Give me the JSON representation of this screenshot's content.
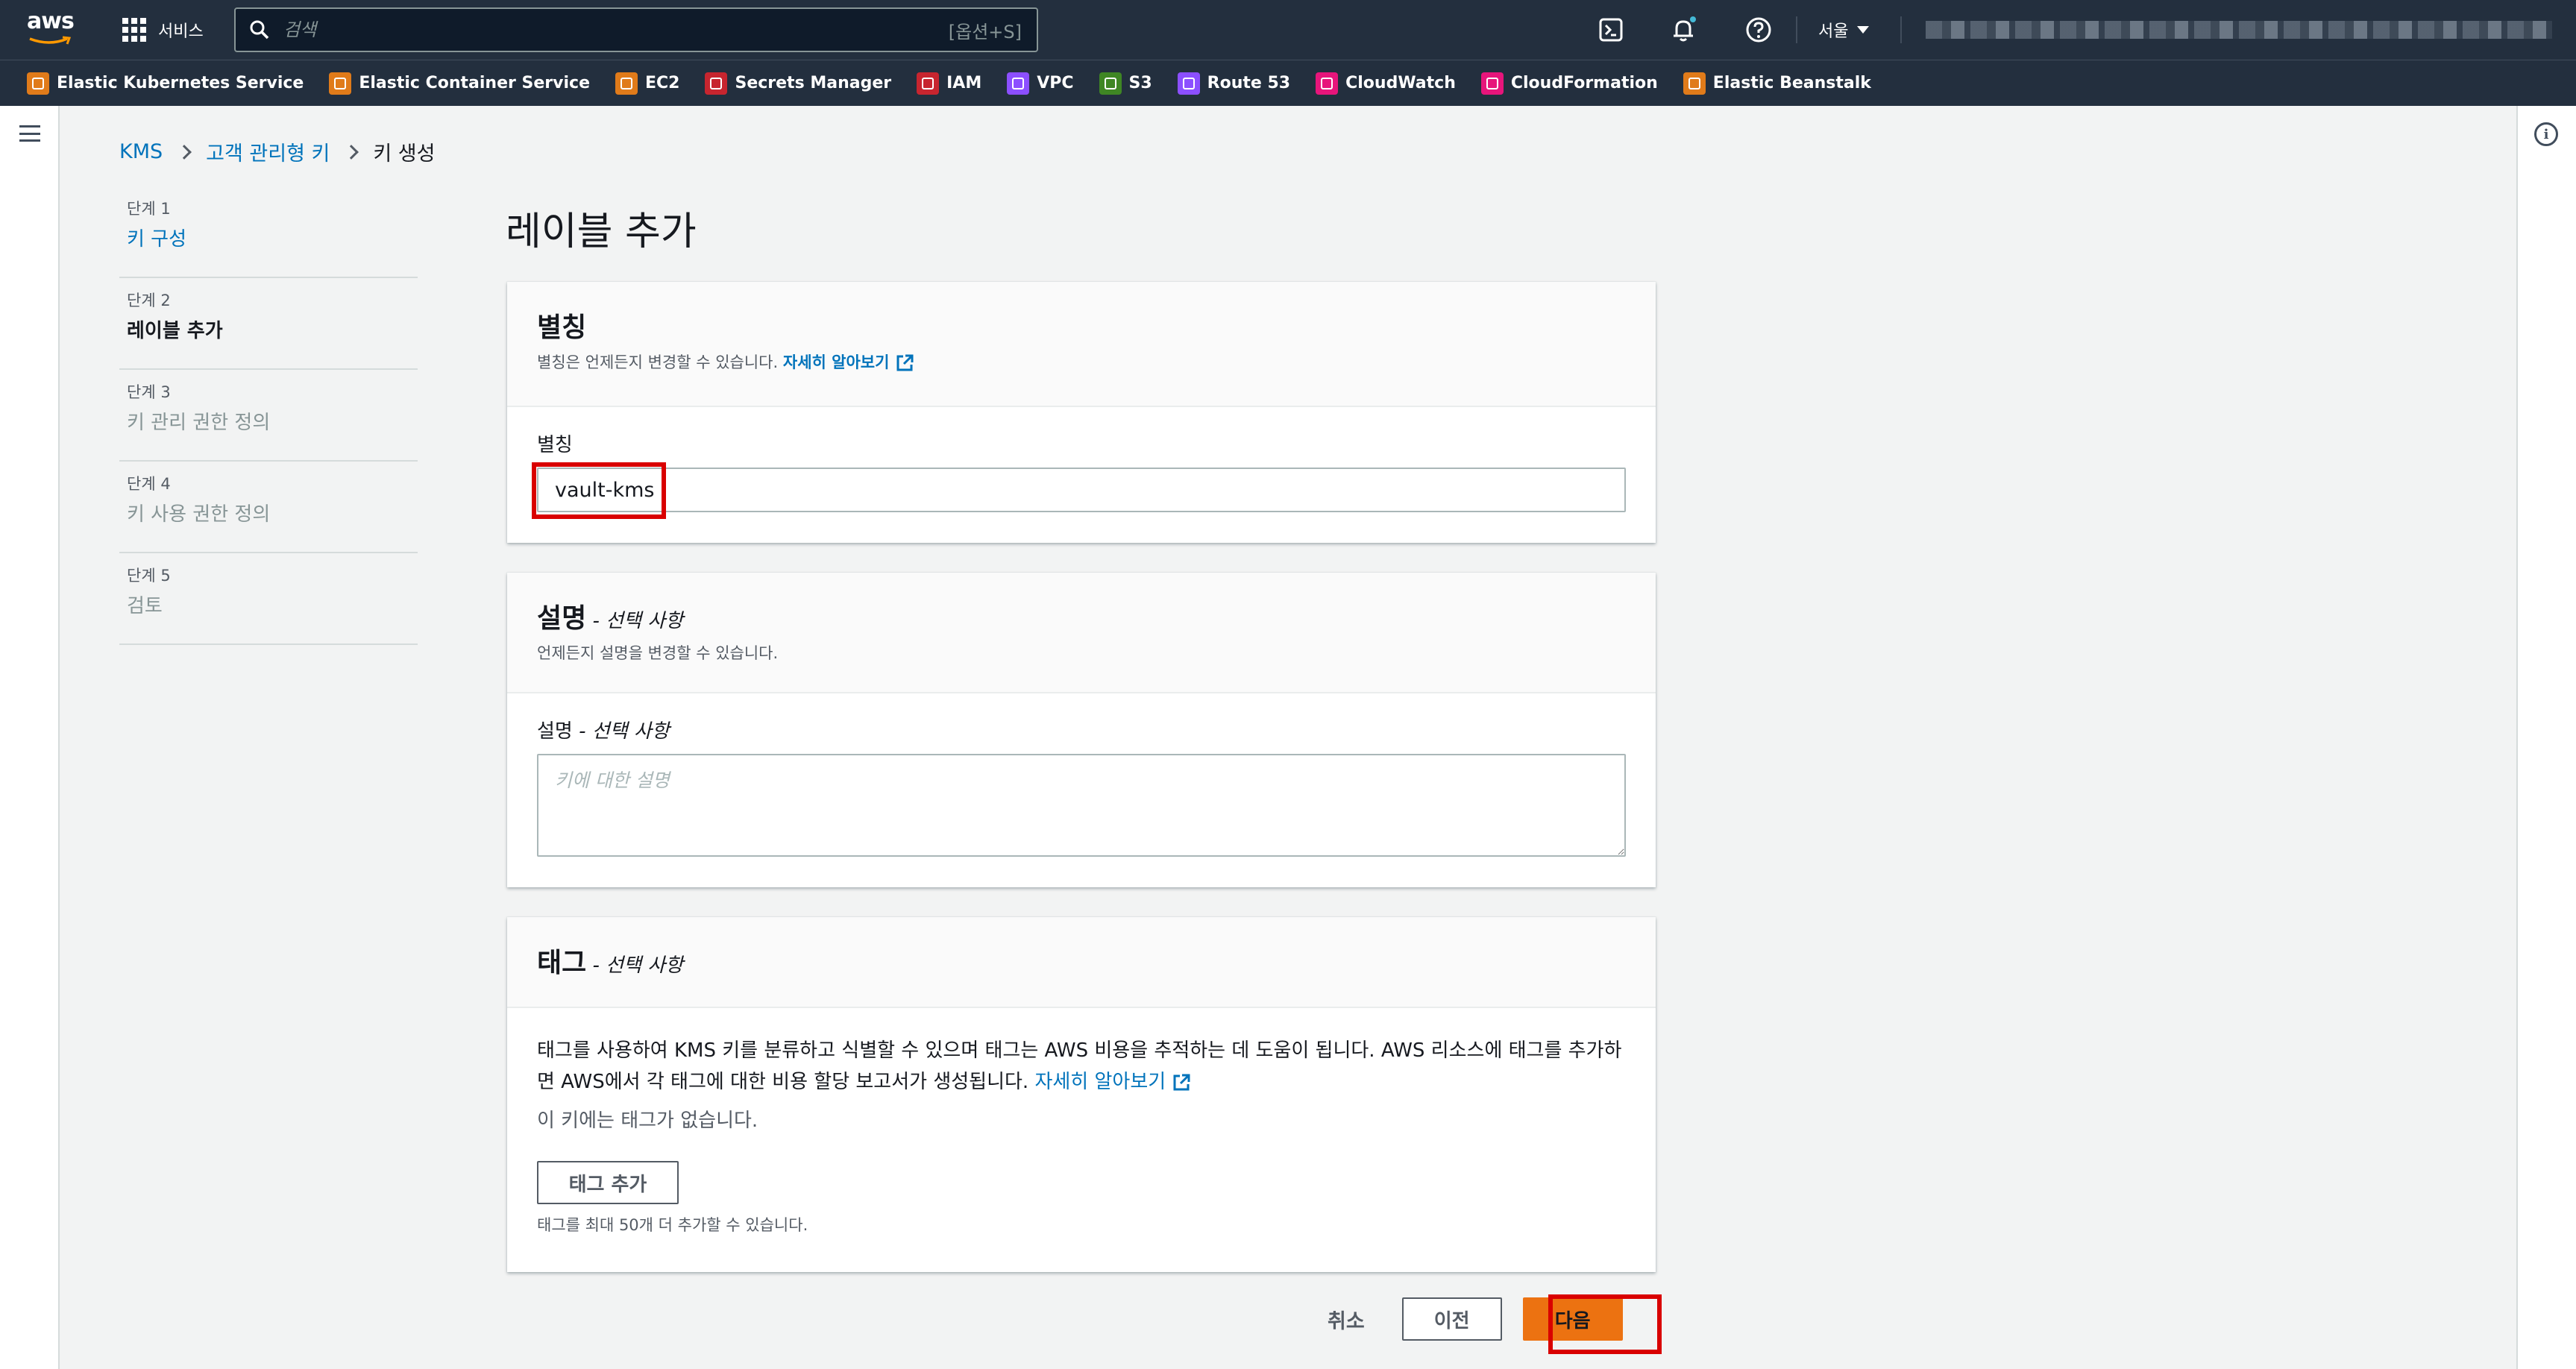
{
  "nav": {
    "logo": "aws",
    "services_label": "서비스",
    "search_placeholder": "검색",
    "search_shortcut": "[옵션+S]",
    "region": "서울",
    "icons": [
      "cloudshell-icon",
      "bell-icon",
      "help-icon"
    ]
  },
  "favorites": [
    {
      "label": "Elastic Kubernetes Service",
      "color": "#e07b1a"
    },
    {
      "label": "Elastic Container Service",
      "color": "#e07b1a"
    },
    {
      "label": "EC2",
      "color": "#e07b1a"
    },
    {
      "label": "Secrets Manager",
      "color": "#c7252f"
    },
    {
      "label": "IAM",
      "color": "#c7252f"
    },
    {
      "label": "VPC",
      "color": "#8c4fff"
    },
    {
      "label": "S3",
      "color": "#3f8624"
    },
    {
      "label": "Route 53",
      "color": "#8c4fff"
    },
    {
      "label": "CloudWatch",
      "color": "#e7157b"
    },
    {
      "label": "CloudFormation",
      "color": "#e7157b"
    },
    {
      "label": "Elastic Beanstalk",
      "color": "#e07b1a"
    }
  ],
  "breadcrumb": {
    "items": [
      "KMS",
      "고객 관리형 키"
    ],
    "current": "키 생성"
  },
  "steps": [
    {
      "num": "단계 1",
      "label": "키 구성",
      "state": "link"
    },
    {
      "num": "단계 2",
      "label": "레이블 추가",
      "state": "active"
    },
    {
      "num": "단계 3",
      "label": "키 관리 권한 정의",
      "state": "disabled"
    },
    {
      "num": "단계 4",
      "label": "키 사용 권한 정의",
      "state": "disabled"
    },
    {
      "num": "단계 5",
      "label": "검토",
      "state": "disabled"
    }
  ],
  "page_title": "레이블 추가",
  "alias_panel": {
    "title": "별칭",
    "desc": "별칭은 언제든지 변경할 수 있습니다.",
    "learn_more": "자세히 알아보기",
    "field_label": "별칭",
    "field_value": "vault-kms"
  },
  "desc_panel": {
    "title": "설명",
    "optional": " - 선택 사항",
    "desc": "언제든지 설명을 변경할 수 있습니다.",
    "field_label": "설명",
    "field_optional": " - 선택 사항",
    "placeholder": "키에 대한 설명"
  },
  "tag_panel": {
    "title": "태그",
    "optional": " - 선택 사항",
    "desc": "태그를 사용하여 KMS 키를 분류하고 식별할 수 있으며 태그는 AWS 비용을 추적하는 데 도움이 됩니다. AWS 리소스에 태그를 추가하면 AWS에서 각 태그에 대한 비용 할당 보고서가 생성됩니다.",
    "learn_more": "자세히 알아보기",
    "no_tags": "이 키에는 태그가 없습니다.",
    "add_button": "태그 추가",
    "hint": "태그를 최대 50개 더 추가할 수 있습니다."
  },
  "footer": {
    "cancel": "취소",
    "previous": "이전",
    "next": "다음"
  },
  "colors": {
    "nav_bg": "#232f3e",
    "link": "#0073bb",
    "primary_button": "#ec7211",
    "highlight": "#d90000"
  }
}
